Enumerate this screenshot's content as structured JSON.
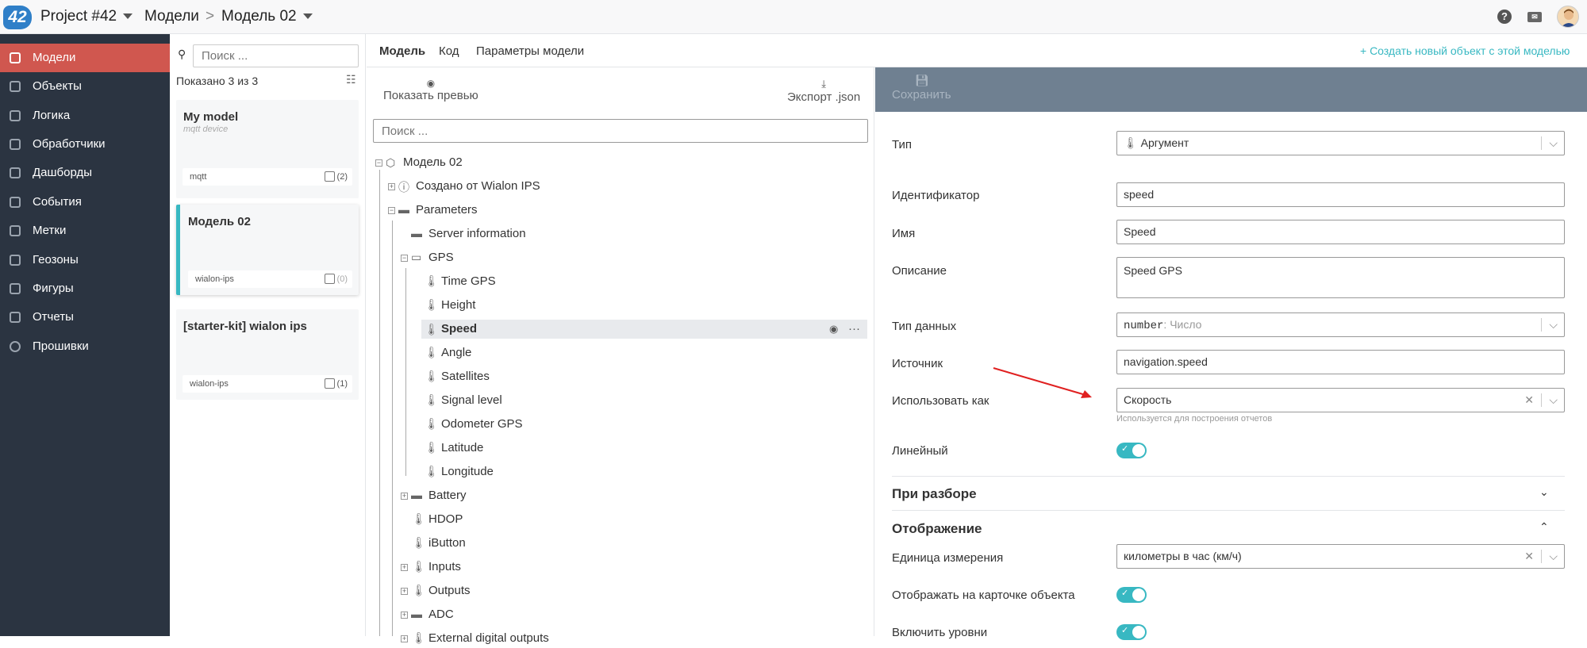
{
  "header": {
    "logo": "42",
    "project": "Project #42",
    "crumb_models": "Модели",
    "crumb_sep": ">",
    "crumb_current": "Модель 02"
  },
  "sidebar": {
    "items": [
      {
        "label": "Модели",
        "icon": "cube-icon",
        "active": true
      },
      {
        "label": "Объекты",
        "icon": "square-icon"
      },
      {
        "label": "Логика",
        "icon": "logic-icon"
      },
      {
        "label": "Обработчики",
        "icon": "handler-icon"
      },
      {
        "label": "Дашборды",
        "icon": "dashboard-icon"
      },
      {
        "label": "События",
        "icon": "events-icon"
      },
      {
        "label": "Метки",
        "icon": "tag-icon"
      },
      {
        "label": "Геозоны",
        "icon": "geozone-icon"
      },
      {
        "label": "Фигуры",
        "icon": "shapes-icon"
      },
      {
        "label": "Отчеты",
        "icon": "report-icon"
      },
      {
        "label": "Прошивки",
        "icon": "firmware-icon"
      }
    ]
  },
  "list": {
    "search_placeholder": "Поиск ...",
    "shown": "Показано 3 из 3",
    "cards": [
      {
        "title": "My model",
        "subtitle": "mqtt device",
        "tag": "mqtt",
        "count": "(2)"
      },
      {
        "title": "Модель 02",
        "subtitle": "",
        "tag": "wialon-ips",
        "count": "(0)"
      },
      {
        "title": "[starter-kit] wialon ips",
        "subtitle": "",
        "tag": "wialon-ips",
        "count": "(1)"
      }
    ]
  },
  "tabs": {
    "model": "Модель",
    "code": "Код",
    "params": "Параметры модели",
    "create": "+ Создать новый объект с этой моделью"
  },
  "tree": {
    "preview": "Показать превью",
    "export": "Экспорт .json",
    "search_placeholder": "Поиск ...",
    "nodes": [
      {
        "label": "Модель 02"
      },
      {
        "label": "Создано от Wialon IPS"
      },
      {
        "label": "Parameters"
      },
      {
        "label": "Server information"
      },
      {
        "label": "GPS"
      },
      {
        "label": "Time GPS"
      },
      {
        "label": "Height"
      },
      {
        "label": "Speed"
      },
      {
        "label": "Angle"
      },
      {
        "label": "Satellites"
      },
      {
        "label": "Signal level"
      },
      {
        "label": "Odometer GPS"
      },
      {
        "label": "Latitude"
      },
      {
        "label": "Longitude"
      },
      {
        "label": "Battery"
      },
      {
        "label": "HDOP"
      },
      {
        "label": "iButton"
      },
      {
        "label": "Inputs"
      },
      {
        "label": "Outputs"
      },
      {
        "label": "ADC"
      },
      {
        "label": "External digital outputs"
      }
    ]
  },
  "form": {
    "save": "Сохранить",
    "type_label": "Тип",
    "type_value": "Аргумент",
    "id_label": "Идентификатор",
    "id_value": "speed",
    "name_label": "Имя",
    "name_value": "Speed",
    "desc_label": "Описание",
    "desc_value": "Speed GPS",
    "dtype_label": "Тип данных",
    "dtype_code": "number",
    "dtype_text": ": Число",
    "source_label": "Источник",
    "source_value": "navigation.speed",
    "useas_label": "Использовать как",
    "useas_value": "Скорость",
    "useas_hint": "Используется для построения отчетов",
    "linear_label": "Линейный",
    "linear_on": true,
    "sect_parse": "При разборе",
    "sect_display": "Отображение",
    "unit_label": "Единица измерения",
    "unit_value": "километры в час (км/ч)",
    "showcard_label": "Отображать на карточке объекта",
    "showcard_on": true,
    "levels_label": "Включить уровни",
    "levels_on": true
  },
  "colors": {
    "accent": "#38b8c2",
    "active": "#d0574f",
    "sidebar": "#2b3441",
    "arrow": "#e02020"
  }
}
